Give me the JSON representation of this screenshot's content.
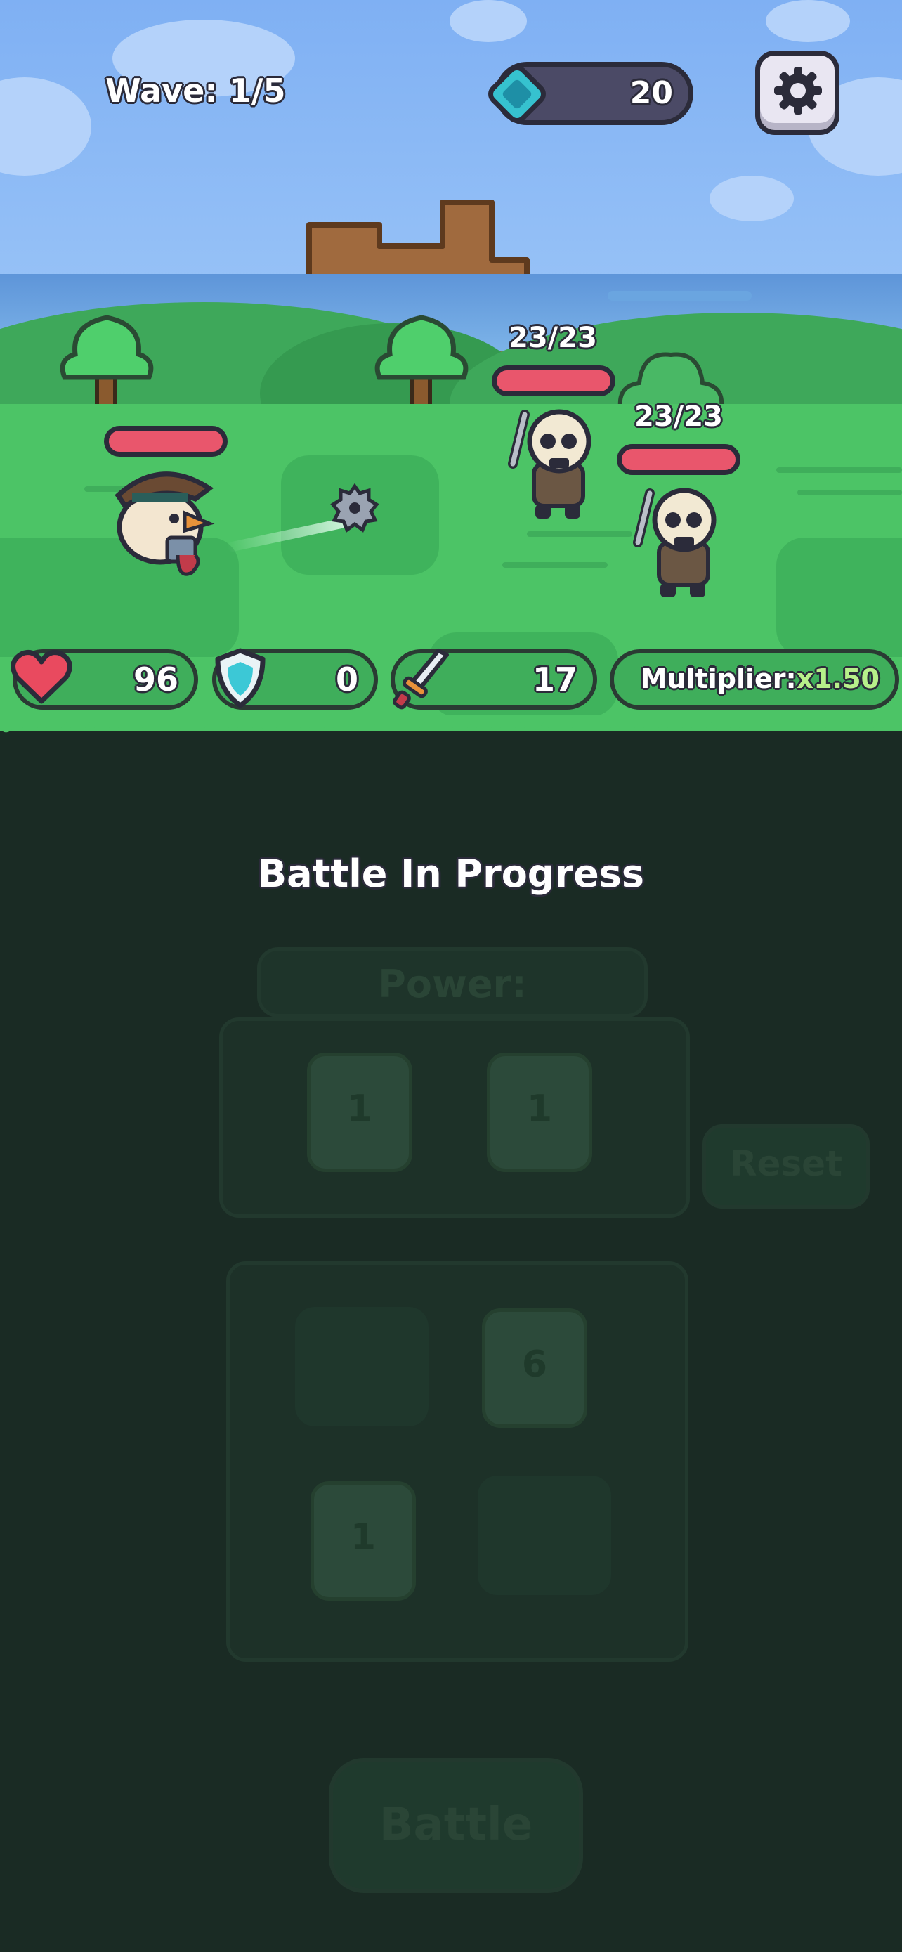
{
  "hud": {
    "wave_label": "Wave: 1/5",
    "gems": "20",
    "settings_icon": "gear-icon",
    "gem_icon": "gem-icon"
  },
  "enemies": [
    {
      "name": "skeleton-1",
      "hp_text": "23/23"
    },
    {
      "name": "skeleton-2",
      "hp_text": "23/23"
    }
  ],
  "stats": {
    "health": "96",
    "shield": "0",
    "attack": "17",
    "multiplier_label": "Multiplier:",
    "multiplier_value": "x1.50"
  },
  "status_text": "Battle In Progress",
  "panel": {
    "power_label": "Power:",
    "reset_label": "Reset",
    "battle_label": "Battle",
    "dice_top": [
      "1",
      "1"
    ],
    "dice_grid": [
      "6",
      "1"
    ]
  },
  "colors": {
    "grass": "#4cc466",
    "panel_bg": "#1a2b24",
    "hp_red": "#e9566c",
    "multiplier_green": "#b7f08a"
  }
}
